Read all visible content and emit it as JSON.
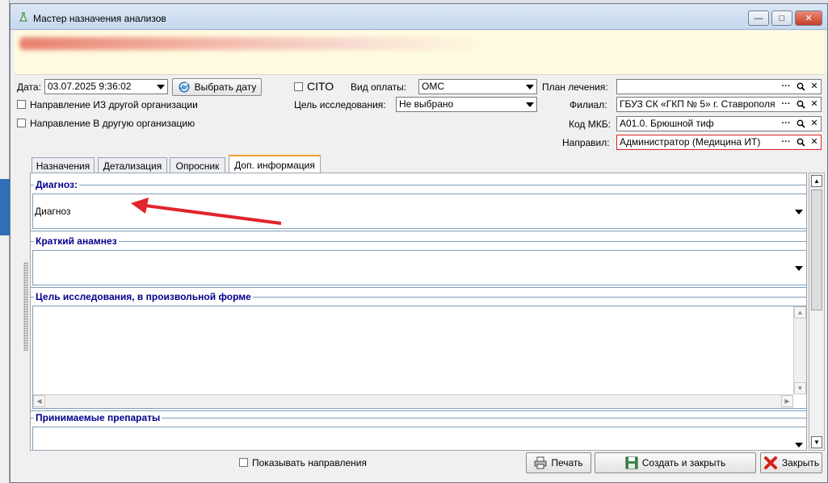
{
  "window": {
    "title": "Мастер назначения анализов",
    "minimize": "—",
    "maximize": "□",
    "close": "✕"
  },
  "form": {
    "date_label": "Дата:",
    "date_value": "03.07.2025 9:36:02",
    "pick_date_button": "Выбрать дату",
    "cito_label": "CITO",
    "payment_label": "Вид оплаты:",
    "payment_value": "ОМС",
    "purpose_label": "Цель исследования:",
    "purpose_value": "Не выбрано",
    "from_org_label": "Направление ИЗ другой организации",
    "to_org_label": "Направление В другую организацию",
    "plan_label": "План лечения:",
    "plan_value": "",
    "branch_label": "Филиал:",
    "branch_value": "ГБУЗ СК «ГКП № 5» г. Ставрополя",
    "mkb_label": "Код МКБ:",
    "mkb_value": "A01.0. Брюшной тиф",
    "referrer_label": "Направил:",
    "referrer_value": "Администратор (Медицина ИТ)"
  },
  "tabs": [
    {
      "label": "Назначения"
    },
    {
      "label": "Детализация"
    },
    {
      "label": "Опросник"
    },
    {
      "label": "Доп. информация"
    }
  ],
  "groups": {
    "diagnosis_title": "Диагноз:",
    "diagnosis_value": "Диагноз",
    "anamnesis_title": "Краткий анамнез",
    "anamnesis_value": "",
    "purpose_free_title": "Цель исследования, в произвольной форме",
    "drugs_title": "Принимаемые препараты"
  },
  "footer": {
    "show_directions_label": "Показывать направления",
    "print_button": "Печать",
    "create_close_button": "Создать и закрыть",
    "close_button": "Закрыть"
  },
  "colors": {
    "accent_red": "#e0242a",
    "group_title": "#00008b",
    "banner_bg": "#fffbe0"
  }
}
